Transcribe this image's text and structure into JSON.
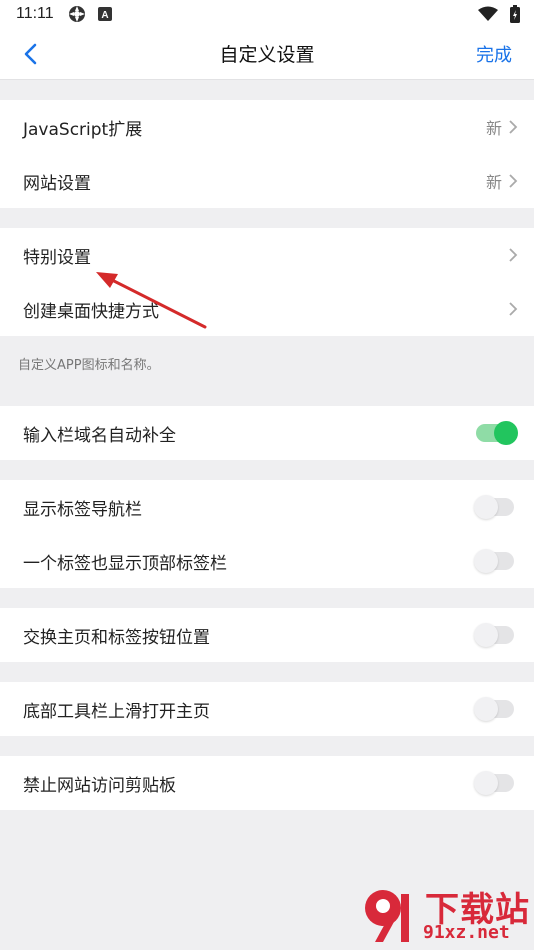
{
  "status_bar": {
    "time": "11:11",
    "icons": [
      "settings-icon",
      "a-icon",
      "wifi-icon",
      "battery-icon"
    ]
  },
  "nav": {
    "title": "自定义设置",
    "done_label": "完成",
    "accent_color": "#1a73e8"
  },
  "sections": {
    "s1": [
      {
        "label": "JavaScript扩展",
        "badge": "新"
      },
      {
        "label": "网站设置",
        "badge": "新"
      }
    ],
    "s2": [
      {
        "label": "特别设置"
      },
      {
        "label": "创建桌面快捷方式"
      }
    ],
    "s2_note": "自定义APP图标和名称。",
    "s3": [
      {
        "label": "输入栏域名自动补全",
        "toggle": true
      }
    ],
    "s4": [
      {
        "label": "显示标签导航栏",
        "toggle": false
      },
      {
        "label": "一个标签也显示顶部标签栏",
        "toggle": false
      }
    ],
    "s5": [
      {
        "label": "交换主页和标签按钮位置",
        "toggle": false
      }
    ],
    "s6": [
      {
        "label": "底部工具栏上滑打开主页",
        "toggle": false
      }
    ],
    "s7": [
      {
        "label": "禁止网站访问剪贴板",
        "toggle": false
      }
    ]
  },
  "colors": {
    "toggle_on": "#22c55e",
    "annotation_arrow": "#d42a2a",
    "watermark": "#d8293a"
  },
  "watermark": {
    "top": "下载站",
    "bottom": "91xz.net"
  }
}
